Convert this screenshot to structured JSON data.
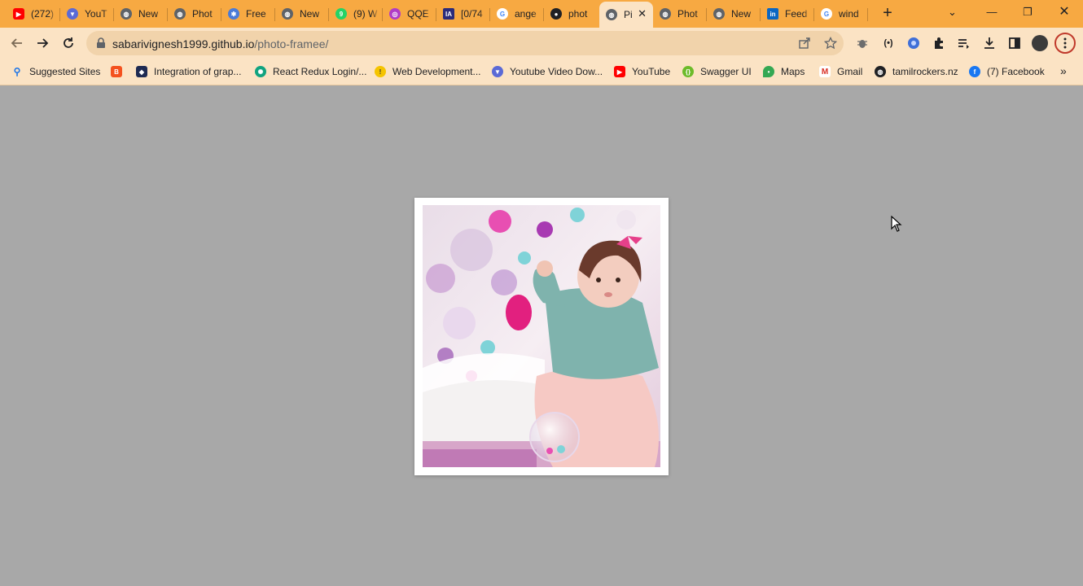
{
  "tabs": [
    {
      "title": "(272)",
      "icon": "youtube-icon",
      "color": "#ff0000"
    },
    {
      "title": "YouT",
      "icon": "download-arrow-icon",
      "color": "#5b6ad6"
    },
    {
      "title": "New",
      "icon": "globe-icon",
      "color": "#5f6368"
    },
    {
      "title": "Phot",
      "icon": "globe-icon",
      "color": "#5f6368"
    },
    {
      "title": "Free",
      "icon": "gear-icon",
      "color": "#4a7bd8"
    },
    {
      "title": "New",
      "icon": "globe-icon",
      "color": "#5f6368"
    },
    {
      "title": "(9) W",
      "icon": "whatsapp-icon",
      "color": "#25d366"
    },
    {
      "title": "QQE",
      "icon": "circle-logo-icon",
      "color": "#b03cc7"
    },
    {
      "title": "[0/74",
      "icon": "ia-icon",
      "color": "#2b2b7a"
    },
    {
      "title": "ange",
      "icon": "google-icon",
      "color": "#4285f4"
    },
    {
      "title": "phot",
      "icon": "github-icon",
      "color": "#202124"
    },
    {
      "title": "Pi",
      "icon": "globe-icon",
      "color": "#5f6368",
      "active": true
    },
    {
      "title": "Phot",
      "icon": "globe-icon",
      "color": "#5f6368"
    },
    {
      "title": "New",
      "icon": "globe-icon",
      "color": "#5f6368"
    },
    {
      "title": "Feed",
      "icon": "linkedin-icon",
      "color": "#0a66c2"
    },
    {
      "title": "wind",
      "icon": "google-icon",
      "color": "#4285f4"
    }
  ],
  "address": {
    "host": "sabarivignesh1999.github.io",
    "path": "/photo-framee/"
  },
  "bookmarks": [
    {
      "label": "Suggested Sites",
      "icon": "search-icon",
      "color": "#1a73e8"
    },
    {
      "label": "",
      "icon": "blogger-icon",
      "color": "#f4511e"
    },
    {
      "label": "Integration of grap...",
      "icon": "dev-icon",
      "color": "#1e2a52"
    },
    {
      "label": "React Redux Login/...",
      "icon": "chatgpt-icon",
      "color": "#10a37f"
    },
    {
      "label": "Web Development...",
      "icon": "bulb-icon",
      "color": "#f5c400"
    },
    {
      "label": "Youtube Video Dow...",
      "icon": "download-arrow-icon",
      "color": "#5b6ad6"
    },
    {
      "label": "YouTube",
      "icon": "youtube-icon",
      "color": "#ff0000"
    },
    {
      "label": "Swagger UI",
      "icon": "swagger-icon",
      "color": "#6dbb2a"
    },
    {
      "label": "Maps",
      "icon": "maps-pin-icon",
      "color": "#34a853"
    },
    {
      "label": "Gmail",
      "icon": "gmail-icon",
      "color": "#d93025"
    },
    {
      "label": "tamilrockers.nz",
      "icon": "globe-dark-icon",
      "color": "#202124"
    },
    {
      "label": "(7) Facebook",
      "icon": "facebook-icon",
      "color": "#1877f2"
    }
  ],
  "colors": {
    "tabstrip": "#f7a942",
    "toolbar": "#fbe3c4",
    "page_background": "#a8a8a8",
    "frame": "#ffffff"
  }
}
